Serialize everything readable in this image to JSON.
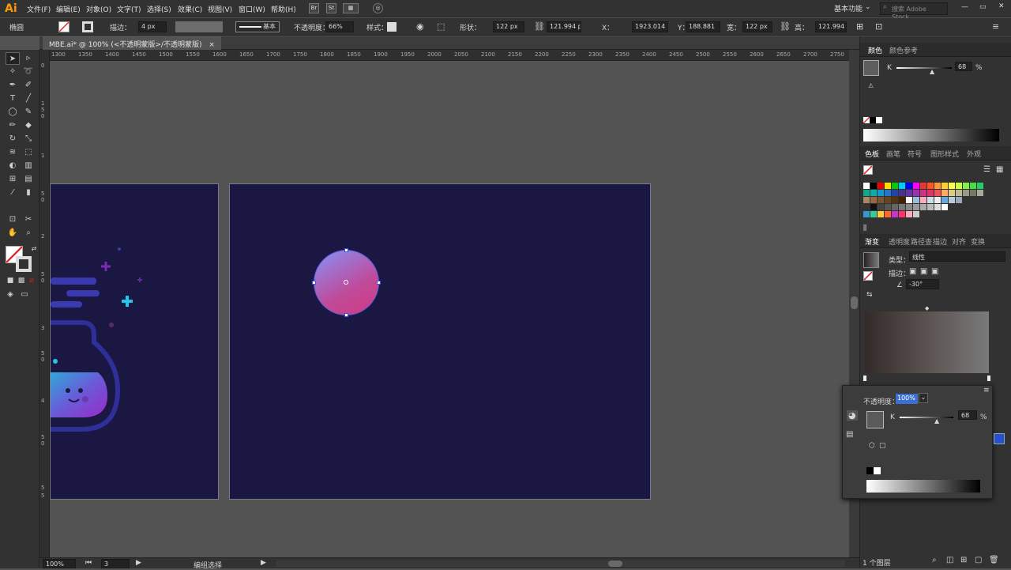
{
  "app": {
    "logo": "Ai"
  },
  "menu": [
    "文件(F)",
    "编辑(E)",
    "对象(O)",
    "文字(T)",
    "选择(S)",
    "效果(C)",
    "视图(V)",
    "窗口(W)",
    "帮助(H)"
  ],
  "menu_buttons": [
    "Br",
    "St"
  ],
  "workspace": "基本功能",
  "stock_search": "搜索 Adobe Stock",
  "control": {
    "object_label": "椭圆",
    "stroke_label": "描边：",
    "stroke_value": "4 px",
    "brush_style": "基本",
    "opacity_label": "不透明度：",
    "opacity_value": "66%",
    "style_label": "样式：",
    "shape_label": "形状：",
    "shape_w": "122 px",
    "x_label": "X：",
    "x_value": "1923.014",
    "y_label": "Y：",
    "y_value": "188.881",
    "w_label": "宽：",
    "w_value": "122 px",
    "h_label": "高：",
    "h_value": "121.994",
    "w2_value": "121.994 px"
  },
  "doc_tab": {
    "title": "MBE.ai* @ 100% (<不透明蒙版>/不透明蒙版)",
    "close": "×"
  },
  "ruler_h": [
    "1300",
    "1350",
    "1400",
    "1450",
    "1500",
    "1550",
    "1600",
    "1650",
    "1700",
    "1750",
    "1800",
    "1850",
    "1900",
    "1950",
    "2000",
    "2050",
    "2100",
    "2150",
    "2200",
    "2250",
    "2300",
    "2350",
    "2400",
    "2450",
    "2500",
    "2550",
    "2600",
    "2650",
    "2700",
    "2750"
  ],
  "ruler_v": [
    "0",
    "1",
    "5",
    "0",
    "1",
    "5",
    "0",
    "2",
    "5",
    "0",
    "3",
    "5",
    "0",
    "4",
    "5",
    "0",
    "5",
    "5"
  ],
  "color_panel": {
    "tab1": "颜色",
    "tab2": "颜色参考",
    "k_label": "K",
    "k_value": "68",
    "pct": "%"
  },
  "swatch_panel": {
    "tabs": [
      "色板",
      "画笔",
      "符号",
      "图形样式",
      "外观"
    ]
  },
  "gradient_panel": {
    "tabs": [
      "渐变",
      "透明度",
      "路径查",
      "描边",
      "对齐",
      "变换"
    ],
    "type_label": "类型：",
    "type_value": "线性",
    "stroke_label": "描边：",
    "angle_value": "-30°"
  },
  "floating": {
    "opacity_label": "不透明度：",
    "opacity_value": "100%",
    "k_label": "K",
    "k_value": "68",
    "pct": "%"
  },
  "status": {
    "zoom": "100%",
    "page": "3",
    "tool_name": "编组选择",
    "layers": "1 个图层"
  },
  "colors": {
    "artboard": "#1a1743",
    "accent": "#3b6fd0"
  }
}
